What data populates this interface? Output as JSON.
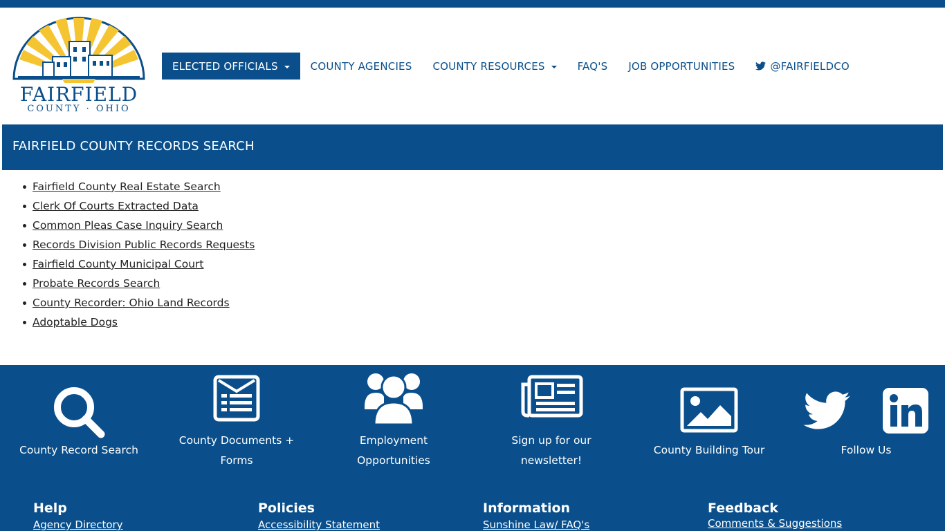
{
  "logo": {
    "name": "FAIRFIELD",
    "subtitle": "COUNTY · OHIO"
  },
  "nav": {
    "items": [
      {
        "label": "ELECTED OFFICIALS",
        "dropdown": true,
        "active": true
      },
      {
        "label": "COUNTY AGENCIES",
        "dropdown": false,
        "active": false
      },
      {
        "label": "COUNTY RESOURCES",
        "dropdown": true,
        "active": false
      },
      {
        "label": "FAQ'S",
        "dropdown": false,
        "active": false
      },
      {
        "label": "JOB OPPORTUNITIES",
        "dropdown": false,
        "active": false
      },
      {
        "label": "@FAIRFIELDCO",
        "icon": "twitter-icon",
        "dropdown": false,
        "active": false
      }
    ]
  },
  "page_title": "FAIRFIELD COUNTY RECORDS SEARCH",
  "links": [
    "Fairfield County Real Estate Search",
    "Clerk Of Courts Extracted Data",
    "Common Pleas Case Inquiry Search",
    "Records Division Public Records Requests",
    "Fairfield County Municipal Court",
    "Probate Records Search",
    "County Recorder: Ohio Land Records",
    "Adoptable Dogs"
  ],
  "tiles": [
    {
      "icon": "search-icon",
      "line1": "County Record Search",
      "line2": ""
    },
    {
      "icon": "document-icon",
      "line1": "County Documents +",
      "line2": "Forms"
    },
    {
      "icon": "users-icon",
      "line1": "Employment",
      "line2": "Opportunities"
    },
    {
      "icon": "newspaper-icon",
      "line1": "Sign up for our",
      "line2": "newsletter!"
    },
    {
      "icon": "image-icon",
      "line1": "County Building Tour",
      "line2": ""
    },
    {
      "icon": "twitter-icon",
      "icon2": "linkedin-icon",
      "line1": "Follow Us",
      "line2": ""
    }
  ],
  "footer_columns": [
    {
      "heading": "Help",
      "link": "Agency Directory"
    },
    {
      "heading": "Policies",
      "link": "Accessibility Statement"
    },
    {
      "heading": "Information",
      "link": "Sunshine Law/ FAQ's"
    },
    {
      "heading": "Feedback",
      "link": "Comments & Suggestions"
    }
  ],
  "colors": {
    "brand": "#0a4f8b",
    "sun": "#f5c531",
    "white": "#ffffff"
  }
}
